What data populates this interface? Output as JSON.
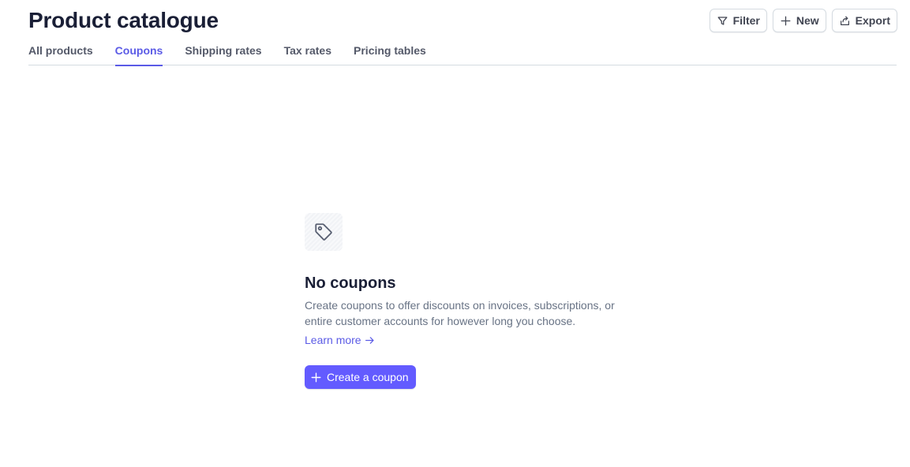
{
  "header": {
    "title": "Product catalogue"
  },
  "toolbar": {
    "filter_label": "Filter",
    "filter_icon": "filter-icon",
    "new_label": "New",
    "new_icon": "plus-icon",
    "export_label": "Export",
    "export_icon": "export-icon"
  },
  "tabs": [
    {
      "label": "All products",
      "active": false
    },
    {
      "label": "Coupons",
      "active": true
    },
    {
      "label": "Shipping rates",
      "active": false
    },
    {
      "label": "Tax rates",
      "active": false
    },
    {
      "label": "Pricing tables",
      "active": false
    }
  ],
  "empty_state": {
    "icon": "tag-icon",
    "title": "No coupons",
    "description": "Create coupons to offer discounts on invoices, subscriptions, or entire customer accounts for however long you choose.",
    "learn_more_label": "Learn more",
    "create_label": "Create a coupon"
  },
  "colors": {
    "accent": "#635bff",
    "tab_active": "#5b5be6",
    "text_primary": "#1a1f36",
    "text_secondary": "#687385",
    "border": "#d5dbe1"
  }
}
